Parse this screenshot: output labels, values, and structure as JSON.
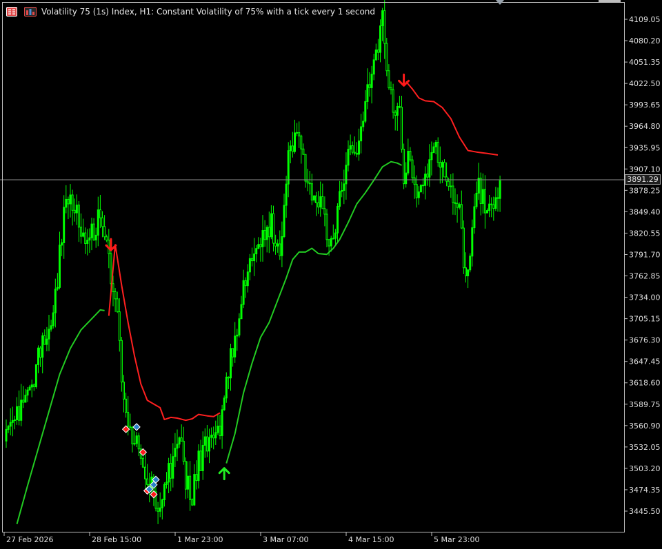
{
  "window": {
    "title": "Volatility 75 (1s) Index, H1:  Constant Volatility of 75% with a tick every 1 second",
    "icons": [
      "trade-panel-icon",
      "depth-of-market-icon"
    ],
    "current_price": "3891.29"
  },
  "colors": {
    "background": "#000000",
    "candle": "#00ff00",
    "axis": "#bfbfbf",
    "text": "#e0e0e0",
    "ma_bear": "#ff2020",
    "ma_bull": "#22cc22",
    "arrow_sell": "#ff1a1a",
    "arrow_buy": "#22ee22",
    "signal_blue": "#2a7fc9"
  },
  "chart_data": {
    "type": "candlestick",
    "symbol": "Volatility 75 (1s) Index",
    "timeframe": "H1",
    "y_ticks": [
      "4109.05",
      "4080.20",
      "4051.35",
      "4022.50",
      "3993.65",
      "3964.80",
      "3935.95",
      "3907.10",
      "3878.25",
      "3849.40",
      "3820.55",
      "3791.70",
      "3762.85",
      "3734.00",
      "3705.15",
      "3676.30",
      "3647.45",
      "3618.60",
      "3589.75",
      "3560.90",
      "3532.05",
      "3503.20",
      "3474.35",
      "3445.50"
    ],
    "x_ticks": [
      "27 Feb 2026",
      "28 Feb 15:00",
      "1 Mar 23:00",
      "3 Mar 07:00",
      "4 Mar 15:00",
      "5 Mar 23:00"
    ],
    "ylim": [
      3428,
      4118
    ],
    "bar_count": 232,
    "bars_per_x_tick": 40,
    "current_price": 3891.29,
    "anchors": [
      [
        0,
        3540
      ],
      [
        4,
        3560
      ],
      [
        8,
        3600
      ],
      [
        12,
        3620
      ],
      [
        16,
        3660
      ],
      [
        20,
        3690
      ],
      [
        24,
        3760
      ],
      [
        28,
        3870
      ],
      [
        32,
        3860
      ],
      [
        36,
        3810
      ],
      [
        40,
        3820
      ],
      [
        44,
        3840
      ],
      [
        48,
        3780
      ],
      [
        51,
        3740
      ],
      [
        54,
        3620
      ],
      [
        57,
        3560
      ],
      [
        60,
        3540
      ],
      [
        63,
        3520
      ],
      [
        66,
        3490
      ],
      [
        69,
        3470
      ],
      [
        72,
        3455
      ],
      [
        75,
        3480
      ],
      [
        78,
        3520
      ],
      [
        81,
        3540
      ],
      [
        84,
        3490
      ],
      [
        87,
        3470
      ],
      [
        90,
        3510
      ],
      [
        93,
        3530
      ],
      [
        96,
        3555
      ],
      [
        100,
        3560
      ],
      [
        104,
        3640
      ],
      [
        108,
        3700
      ],
      [
        112,
        3760
      ],
      [
        116,
        3800
      ],
      [
        120,
        3820
      ],
      [
        124,
        3830
      ],
      [
        128,
        3800
      ],
      [
        132,
        3920
      ],
      [
        136,
        3950
      ],
      [
        140,
        3900
      ],
      [
        144,
        3870
      ],
      [
        148,
        3850
      ],
      [
        152,
        3800
      ],
      [
        156,
        3870
      ],
      [
        160,
        3920
      ],
      [
        164,
        3930
      ],
      [
        168,
        4000
      ],
      [
        172,
        4050
      ],
      [
        176,
        4110
      ],
      [
        178,
        4050
      ],
      [
        180,
        4000
      ],
      [
        184,
        3980
      ],
      [
        186,
        3900
      ],
      [
        188,
        3930
      ],
      [
        192,
        3880
      ],
      [
        196,
        3900
      ],
      [
        200,
        3940
      ],
      [
        204,
        3900
      ],
      [
        208,
        3870
      ],
      [
        212,
        3850
      ],
      [
        214,
        3780
      ],
      [
        216,
        3770
      ],
      [
        218,
        3820
      ],
      [
        221,
        3880
      ],
      [
        224,
        3860
      ],
      [
        227,
        3850
      ],
      [
        230,
        3870
      ],
      [
        231,
        3885
      ]
    ],
    "ma": {
      "name": "",
      "points": [
        [
          5,
          3428
        ],
        [
          10,
          3480
        ],
        [
          15,
          3530
        ],
        [
          20,
          3580
        ],
        [
          25,
          3630
        ],
        [
          30,
          3665
        ],
        [
          35,
          3690
        ],
        [
          40,
          3705
        ],
        [
          44,
          3717
        ],
        [
          46,
          3716
        ],
        [
          48,
          3709
        ],
        [
          51,
          3805
        ],
        [
          54,
          3750
        ],
        [
          57,
          3700
        ],
        [
          60,
          3655
        ],
        [
          63,
          3617
        ],
        [
          66,
          3595
        ],
        [
          69,
          3590
        ],
        [
          72,
          3585
        ],
        [
          74,
          3569
        ],
        [
          77,
          3572
        ],
        [
          80,
          3571
        ],
        [
          84,
          3568
        ],
        [
          87,
          3570
        ],
        [
          90,
          3576
        ],
        [
          94,
          3574
        ],
        [
          97,
          3573
        ],
        [
          100,
          3578
        ],
        [
          103,
          3510
        ],
        [
          107,
          3550
        ],
        [
          111,
          3605
        ],
        [
          115,
          3645
        ],
        [
          119,
          3680
        ],
        [
          123,
          3700
        ],
        [
          127,
          3730
        ],
        [
          131,
          3760
        ],
        [
          134,
          3785
        ],
        [
          137,
          3795
        ],
        [
          140,
          3795
        ],
        [
          143,
          3800
        ],
        [
          146,
          3793
        ],
        [
          150,
          3792
        ],
        [
          153,
          3800
        ],
        [
          156,
          3812
        ],
        [
          160,
          3835
        ],
        [
          164,
          3860
        ],
        [
          168,
          3875
        ],
        [
          172,
          3892
        ],
        [
          176,
          3910
        ],
        [
          180,
          3917
        ],
        [
          183,
          3915
        ],
        [
          185,
          3912
        ],
        [
          187,
          4025
        ],
        [
          190,
          4015
        ],
        [
          193,
          4003
        ],
        [
          196,
          3999
        ],
        [
          200,
          3998
        ],
        [
          204,
          3990
        ],
        [
          208,
          3975
        ],
        [
          212,
          3950
        ],
        [
          216,
          3932
        ],
        [
          220,
          3930
        ],
        [
          225,
          3928
        ],
        [
          230,
          3926
        ]
      ],
      "bullish_segments": [
        [
          5,
          46
        ],
        [
          103,
          185
        ]
      ],
      "bearish_segments": [
        [
          48,
          100
        ],
        [
          187,
          230
        ]
      ]
    },
    "signals": [
      {
        "type": "sell-arrow",
        "bar": 49,
        "price": 3805
      },
      {
        "type": "buy-arrow",
        "bar": 102,
        "price": 3496
      },
      {
        "type": "sell-arrow",
        "bar": 186,
        "price": 4027
      },
      {
        "type": "red-diamond",
        "bar": 56,
        "price": 3556
      },
      {
        "type": "blue-diamond",
        "bar": 61,
        "price": 3559
      },
      {
        "type": "red-diamond",
        "bar": 64,
        "price": 3525
      },
      {
        "type": "blue-diamond",
        "bar": 70,
        "price": 3488
      },
      {
        "type": "blue-diamond",
        "bar": 69,
        "price": 3481
      },
      {
        "type": "red-diamond",
        "bar": 66,
        "price": 3473
      },
      {
        "type": "blue-diamond",
        "bar": 67,
        "price": 3475
      },
      {
        "type": "red-diamond",
        "bar": 69,
        "price": 3468
      }
    ]
  }
}
